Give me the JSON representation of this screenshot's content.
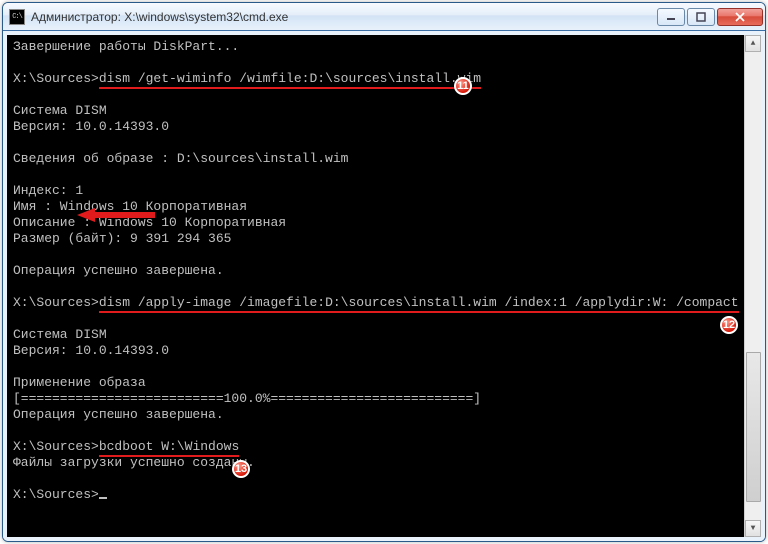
{
  "titlebar": {
    "icon_label": "C:\\",
    "title": "Администратор: X:\\windows\\system32\\cmd.exe"
  },
  "badges": {
    "b11": "11",
    "b12": "12",
    "b13": "13"
  },
  "console": {
    "l01": "Завершение работы DiskPart...",
    "l02": "",
    "l03_prompt": "X:\\Sources>",
    "l03_cmd": "dism /get-wiminfo /wimfile:D:\\sources\\install.wim",
    "l04": "",
    "l05": "Cистема DISM",
    "l06": "Версия: 10.0.14393.0",
    "l07": "",
    "l08": "Сведения об образе : D:\\sources\\install.wim",
    "l09": "",
    "l10": "Индекс: 1",
    "l11": "Имя : Windows 10 Корпоративная",
    "l12": "Описание : Windows 10 Корпоративная",
    "l13": "Размер (байт): 9 391 294 365",
    "l14": "",
    "l15": "Операция успешно завершена.",
    "l16": "",
    "l17_prompt": "X:\\Sources>",
    "l17_cmd": "dism /apply-image /imagefile:D:\\sources\\install.wim /index:1 /applydir:W: /compact",
    "l18": "",
    "l19": "Cистема DISM",
    "l20": "Версия: 10.0.14393.0",
    "l21": "",
    "l22": "Применение образа",
    "l23": "[==========================100.0%==========================]",
    "l24": "Операция успешно завершена.",
    "l25": "",
    "l26_prompt": "X:\\Sources>",
    "l26_cmd": "bcdboot W:\\Windows",
    "l27": "Файлы загрузки успешно созданы.",
    "l28": "",
    "l29": "X:\\Sources>"
  }
}
